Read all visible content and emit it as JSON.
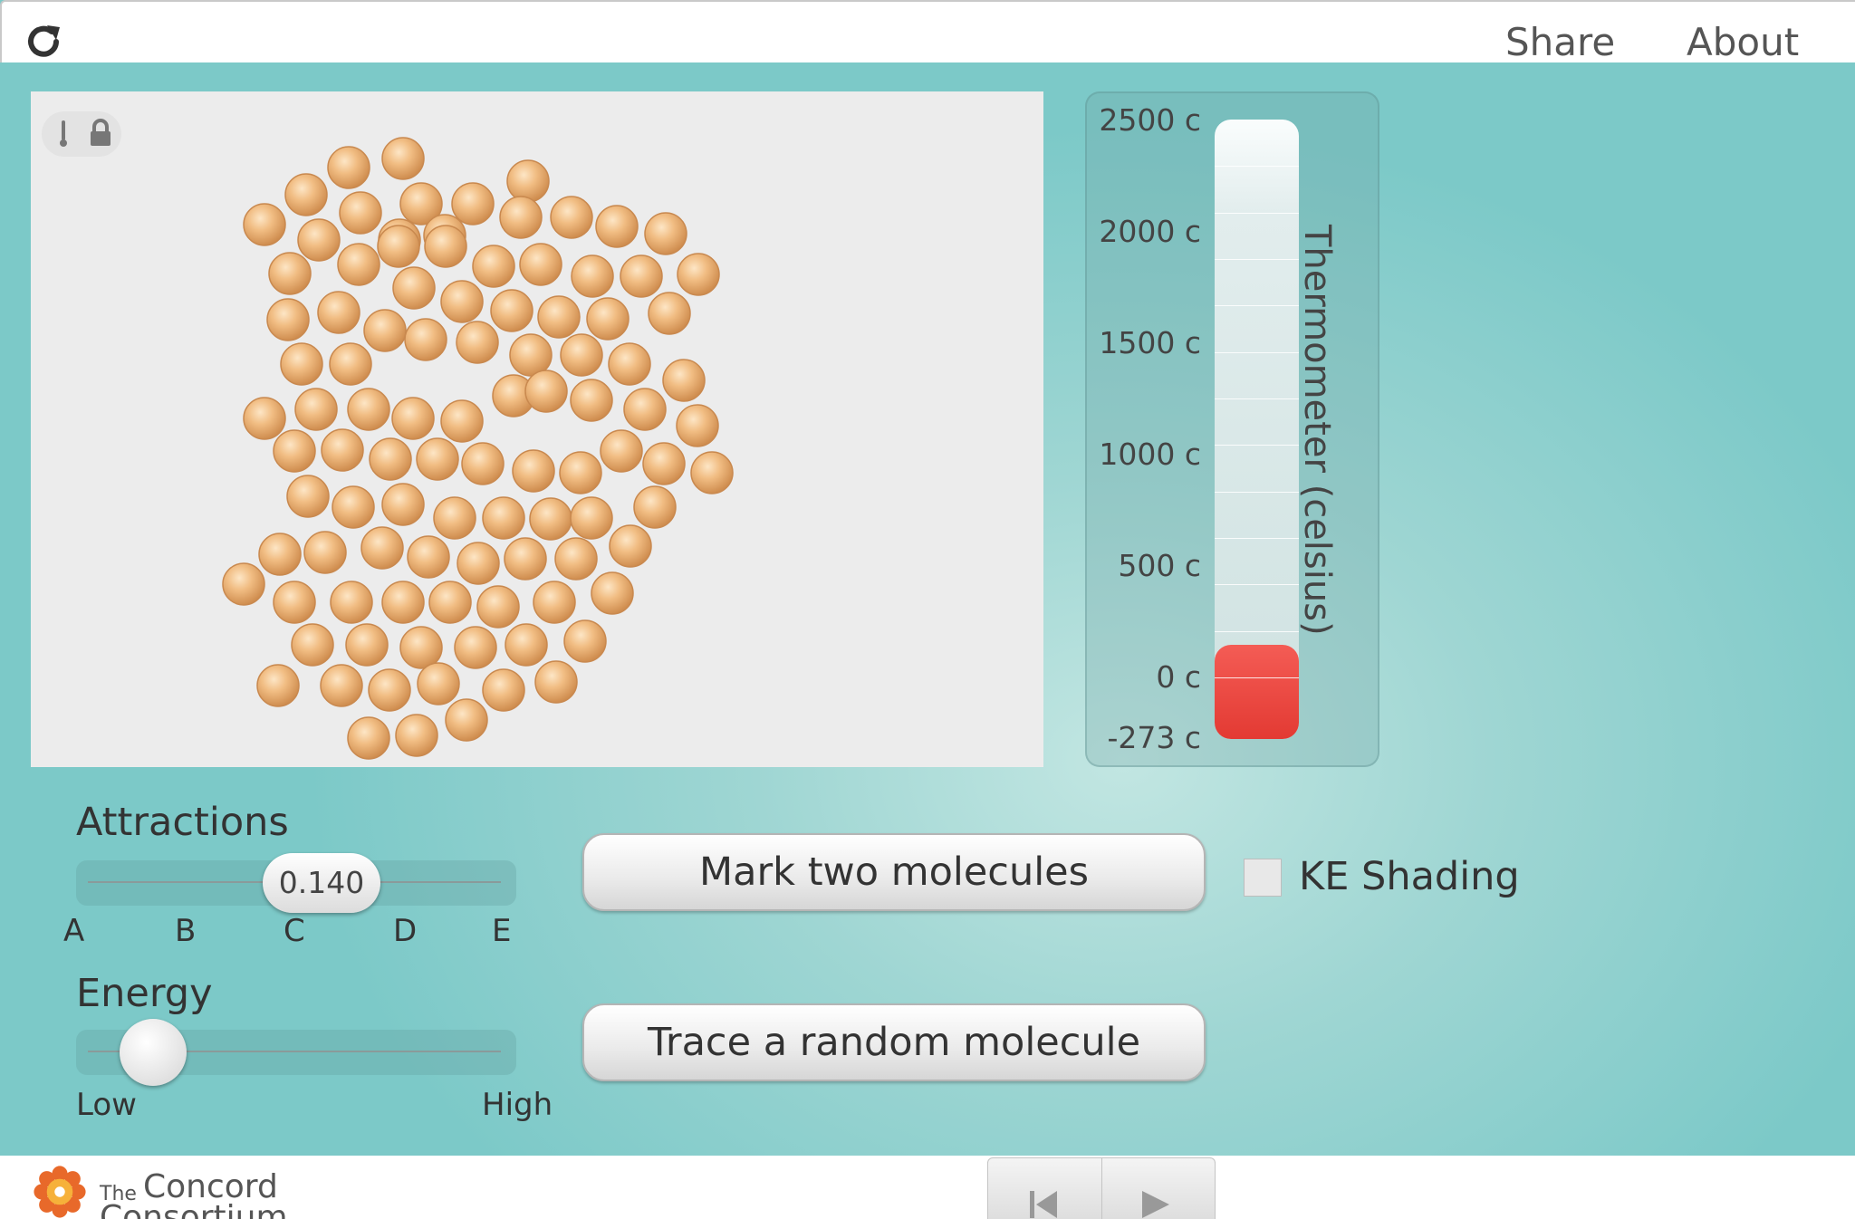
{
  "header": {
    "share_label": "Share",
    "about_label": "About",
    "reload_icon": "reload-icon"
  },
  "simulation": {
    "molecule_color": "#e7a86a",
    "toolbar_icons": [
      "thermometer-icon",
      "lock-icon"
    ]
  },
  "thermometer": {
    "title": "Thermometer (celsius)",
    "scale_labels": [
      "2500 c",
      "2000 c",
      "1500 c",
      "1000 c",
      "500 c",
      "0 c",
      "-273 c"
    ],
    "current_temperature_c": 0,
    "fill_color": "#e53d36"
  },
  "controls": {
    "attractions": {
      "label": "Attractions",
      "value": "0.140",
      "scale_labels": [
        "A",
        "B",
        "C",
        "D",
        "E"
      ]
    },
    "energy": {
      "label": "Energy",
      "min_label": "Low",
      "max_label": "High",
      "level": 0.07
    },
    "mark_button": "Mark two molecules",
    "trace_button": "Trace a random molecule",
    "ke_shading": {
      "label": "KE Shading",
      "checked": false
    }
  },
  "footer": {
    "logo_text_small": "The",
    "logo_text_line1": "Concord",
    "logo_text_line2": "Consortium",
    "playback_icons": [
      "reset-icon",
      "play-icon"
    ]
  }
}
